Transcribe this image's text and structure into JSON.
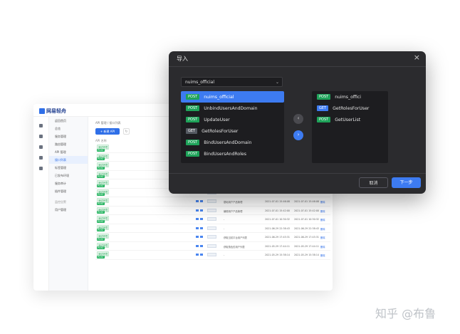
{
  "app": {
    "brand": "网易轻舟",
    "sidebar": [
      "返回首页",
      "总览",
      "服务管理",
      "路由管理",
      "API 管理",
      "接口列表",
      "标签管理",
      "已发布环境",
      "服务审计",
      "插件管理",
      "监控告警",
      "用户管理"
    ],
    "breadcrumb": "API 管理 / 接口列表",
    "new_button": "+ 新建 API",
    "table_header": "API 名称",
    "rows": [
      {
        "tag": "测试环境",
        "method": "POST",
        "desc": "",
        "t1": "",
        "t2": "",
        "op": ""
      },
      {
        "tag": "测试环境",
        "method": "POST",
        "desc": "",
        "t1": "",
        "t2": "",
        "op": ""
      },
      {
        "tag": "测试环境",
        "method": "POST",
        "desc": "",
        "t1": "",
        "t2": "",
        "op": ""
      },
      {
        "tag": "测试环境",
        "method": "POST",
        "desc": "",
        "t1": "",
        "t2": "",
        "op": ""
      },
      {
        "tag": "测试环境",
        "method": "POST",
        "desc": "",
        "t1": "",
        "t2": "",
        "op": ""
      },
      {
        "tag": "测试环境",
        "method": "POST",
        "desc": "",
        "t1": "",
        "t2": "",
        "op": ""
      },
      {
        "tag": "测试环境",
        "method": "POST",
        "desc": "基础用户产品管理",
        "t1": "2021-07-01 15:46:08",
        "t2": "2021-07-01 15:46:08",
        "op": "删除"
      },
      {
        "tag": "测试环境",
        "method": "POST",
        "desc": "编辑用户产品管理",
        "t1": "2021-07-01 15:42:00",
        "t2": "2021-07-01 15:42:00",
        "op": "删除"
      },
      {
        "tag": "测试环境",
        "method": "POST",
        "desc": "-",
        "t1": "2021-07-01 10:30:32",
        "t2": "2021-07-01 10:30:32",
        "op": "删除"
      },
      {
        "tag": "测试环境",
        "method": "POST",
        "desc": "-",
        "t1": "2021-06-29 22:38:43",
        "t2": "2021-06-29 22:38:43",
        "op": "删除"
      },
      {
        "tag": "测试环境",
        "method": "POST",
        "desc": "获取当前平台用户列表",
        "t1": "2021-06-29 17:45:31",
        "t2": "2021-06-29 17:45:31",
        "op": "删除"
      },
      {
        "tag": "测试环境",
        "method": "POST",
        "desc": "获取角色的用户列表",
        "t1": "2021-05-29 17:44:11",
        "t2": "2021-05-29 17:44:11",
        "op": "删除"
      },
      {
        "tag": "测试环境",
        "method": "POST",
        "desc": "-",
        "t1": "2021-05-29 15:38:14",
        "t2": "2021-05-29 15:38:14",
        "op": "删除"
      }
    ]
  },
  "modal": {
    "title": "导入",
    "select_value": "nuims_official",
    "source_items": [
      {
        "method": "POST",
        "name": "nuims_official",
        "selected": true
      },
      {
        "method": "POST",
        "name": "UnbindUsersAndDomain",
        "selected": false
      },
      {
        "method": "POST",
        "name": "UpdateUser",
        "selected": false
      },
      {
        "method": "GET",
        "name": "GetRolesForUser",
        "selected": false
      },
      {
        "method": "POST",
        "name": "BindUsersAndDomain",
        "selected": false
      },
      {
        "method": "POST",
        "name": "BindUsersAndRoles",
        "selected": false
      }
    ],
    "target_items": [
      {
        "method": "POST",
        "name": "nuims_offici"
      },
      {
        "method": "GET",
        "name": "GetRolesForUser"
      },
      {
        "method": "POST",
        "name": "GetUserList"
      }
    ],
    "cancel_label": "取消",
    "next_label": "下一步"
  },
  "watermark": "知乎 @布鲁"
}
